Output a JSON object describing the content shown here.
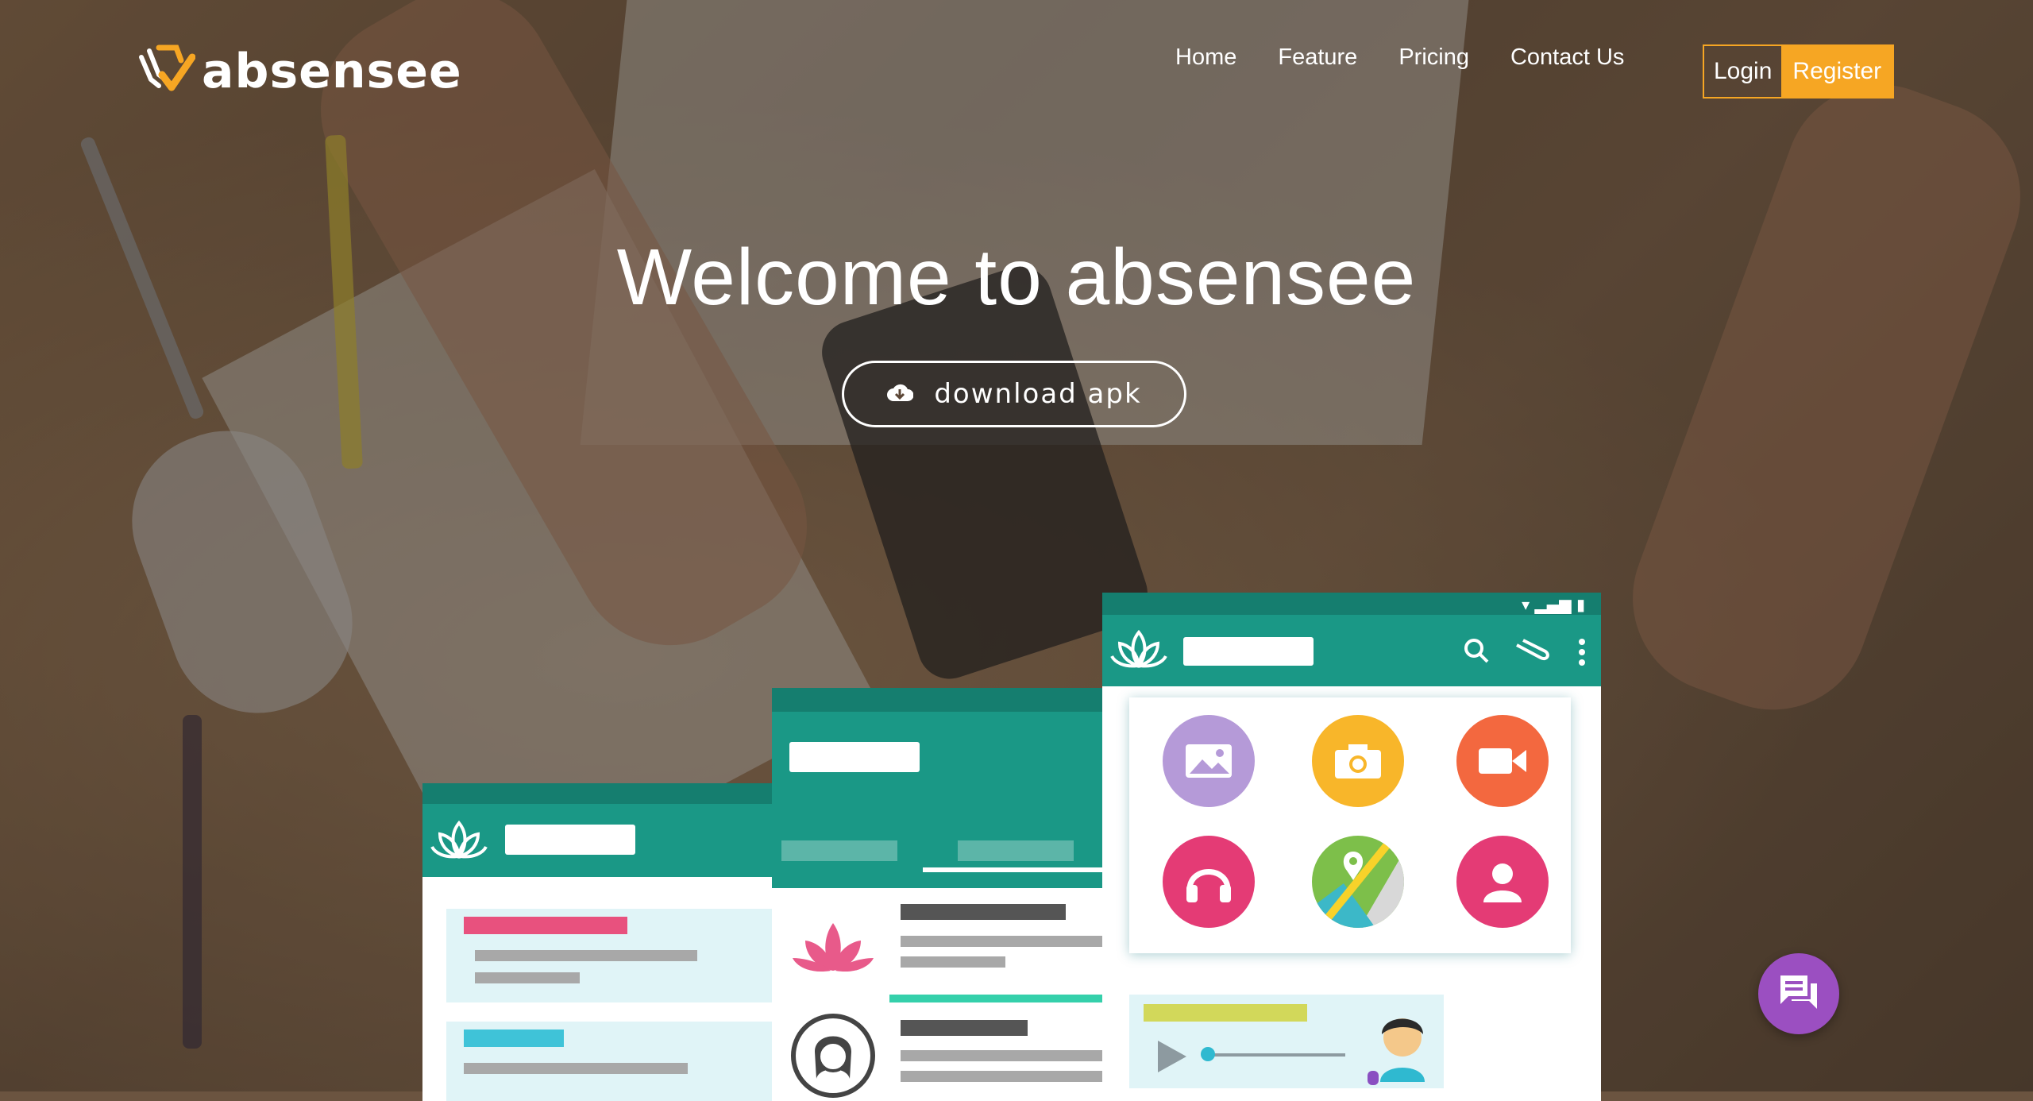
{
  "brand": {
    "name": "absensee"
  },
  "nav": {
    "items": [
      "Home",
      "Feature",
      "Pricing",
      "Contact Us"
    ],
    "login": "Login",
    "register": "Register"
  },
  "hero": {
    "title": "Welcome to absensee",
    "download_label": "download apk",
    "download_icon": "cloud-download-icon"
  },
  "colors": {
    "accent": "#f6a623",
    "teal": "#1a9886",
    "chat": "#9b4fc1"
  },
  "mockup": {
    "app_icons": [
      "image-icon",
      "camera-icon",
      "video-icon",
      "headphones-icon",
      "map-icon",
      "profile-icon"
    ],
    "chat_icon": "chat-bubble-icon"
  }
}
